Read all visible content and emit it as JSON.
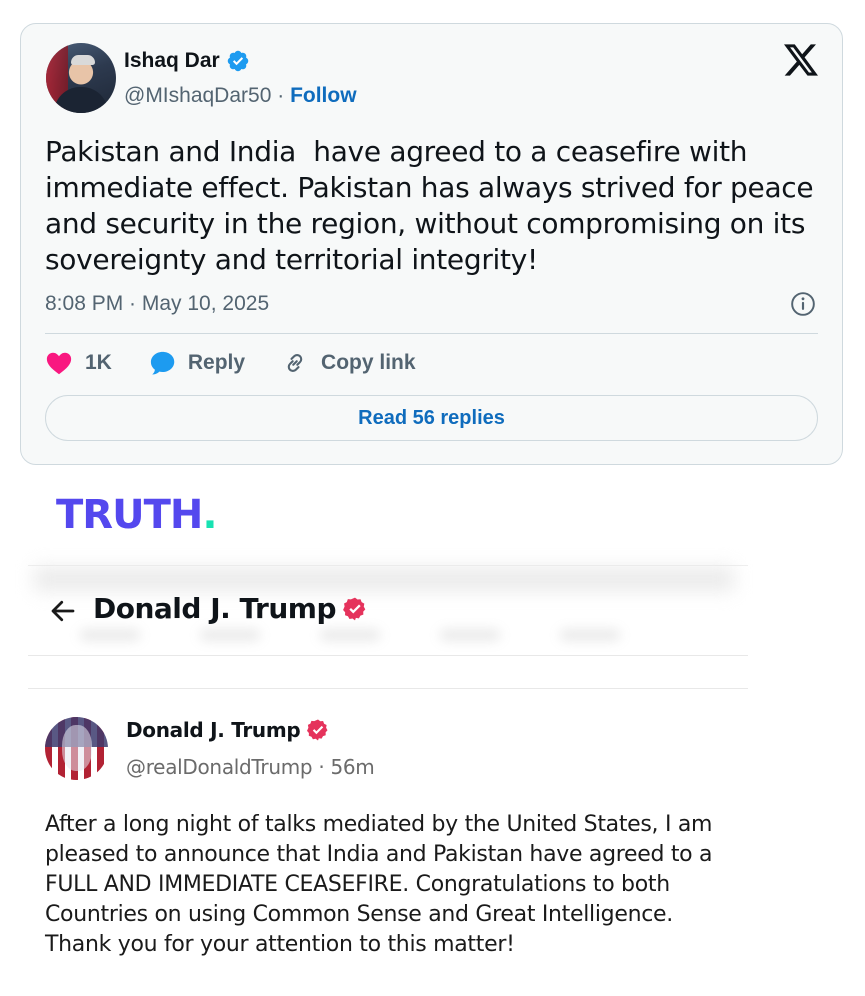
{
  "tweet": {
    "author_name": "Ishaq Dar",
    "handle": "@MIshaqDar50",
    "separator": " · ",
    "follow_label": "Follow",
    "text": "Pakistan and India  have agreed to a ceasefire with immediate effect. Pakistan has always strived for peace and security in the region, without compromising on its sovereignty and territorial integrity!",
    "timestamp": "8:08 PM · May 10, 2025",
    "like_count": "1K",
    "reply_label": "Reply",
    "copy_link_label": "Copy link",
    "read_replies_label": "Read 56 replies",
    "colors": {
      "verified": "#1d9bf0",
      "link": "#0f6cbd",
      "like": "#f91880"
    }
  },
  "truth": {
    "logo_text": "TRUTH",
    "logo_dot": ".",
    "header_title": "Donald J. Trump",
    "post": {
      "author_name": "Donald J. Trump",
      "handle_time": "@realDonaldTrump · 56m",
      "text": "After a long night of talks mediated by the United States, I am pleased to announce that India and Pakistan have agreed to a FULL AND IMMEDIATE CEASEFIRE. Congratulations to both Countries on using Common Sense and Great Intelligence. Thank you for your attention to this matter!"
    },
    "colors": {
      "brand": "#5448ee",
      "accent": "#17e2b2",
      "verified": "#e5335c"
    }
  }
}
